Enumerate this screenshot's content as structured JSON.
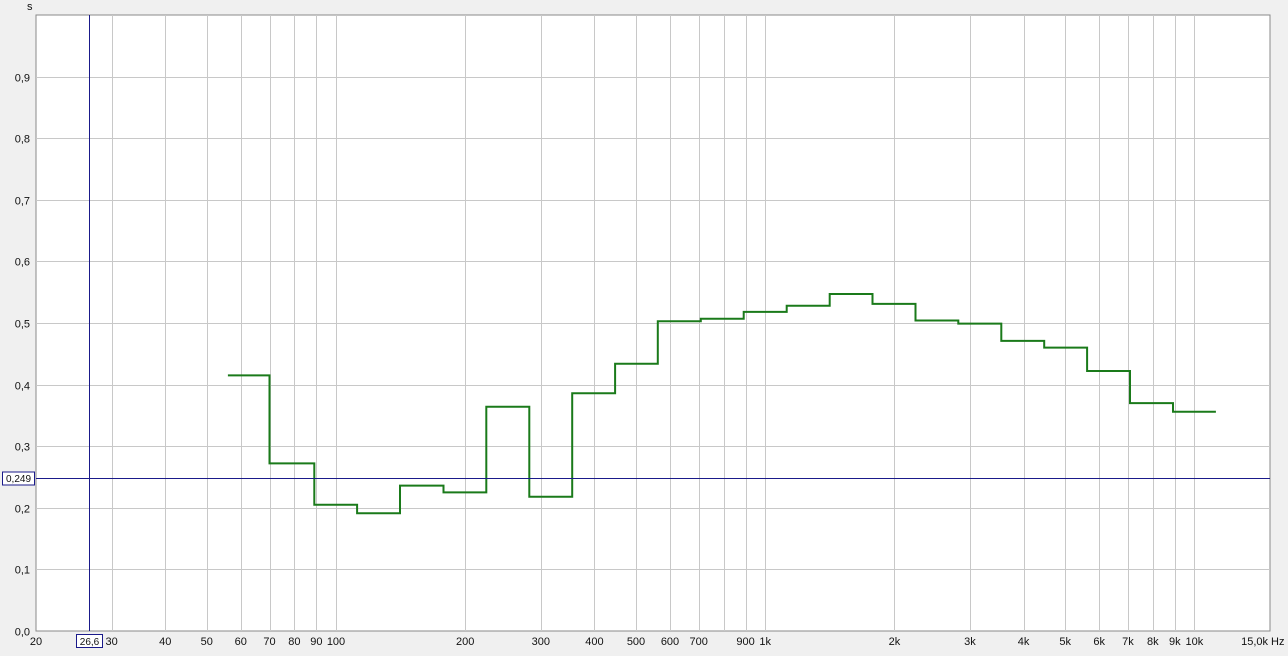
{
  "chart_data": {
    "type": "line",
    "title": "",
    "y_unit": "s",
    "x_unit": "Hz",
    "x_scale": "log",
    "xlim": [
      20,
      15000
    ],
    "ylim": [
      0,
      1.0
    ],
    "grid": true,
    "x_tick_labels": [
      {
        "value": 20,
        "label": "20"
      },
      {
        "value": 30,
        "label": "30"
      },
      {
        "value": 40,
        "label": "40"
      },
      {
        "value": 50,
        "label": "50"
      },
      {
        "value": 60,
        "label": "60"
      },
      {
        "value": 70,
        "label": "70"
      },
      {
        "value": 80,
        "label": "80"
      },
      {
        "value": 90,
        "label": "90"
      },
      {
        "value": 100,
        "label": "100"
      },
      {
        "value": 200,
        "label": "200"
      },
      {
        "value": 300,
        "label": "300"
      },
      {
        "value": 400,
        "label": "400"
      },
      {
        "value": 500,
        "label": "500"
      },
      {
        "value": 600,
        "label": "600"
      },
      {
        "value": 700,
        "label": "700"
      },
      {
        "value": 900,
        "label": "900"
      },
      {
        "value": 1000,
        "label": "1k"
      },
      {
        "value": 2000,
        "label": "2k"
      },
      {
        "value": 3000,
        "label": "3k"
      },
      {
        "value": 4000,
        "label": "4k"
      },
      {
        "value": 5000,
        "label": "5k"
      },
      {
        "value": 6000,
        "label": "6k"
      },
      {
        "value": 7000,
        "label": "7k"
      },
      {
        "value": 8000,
        "label": "8k"
      },
      {
        "value": 9000,
        "label": "9k"
      },
      {
        "value": 10000,
        "label": "10k"
      },
      {
        "value": 15000,
        "label": "15,0k"
      }
    ],
    "x_grid_values": [
      30,
      40,
      50,
      60,
      70,
      80,
      90,
      100,
      200,
      300,
      400,
      500,
      600,
      700,
      800,
      900,
      1000,
      2000,
      3000,
      4000,
      5000,
      6000,
      7000,
      8000,
      9000,
      10000
    ],
    "y_tick_labels": [
      {
        "value": 0.0,
        "label": "0,0"
      },
      {
        "value": 0.1,
        "label": "0,1"
      },
      {
        "value": 0.2,
        "label": "0,2"
      },
      {
        "value": 0.3,
        "label": "0,3"
      },
      {
        "value": 0.4,
        "label": "0,4"
      },
      {
        "value": 0.5,
        "label": "0,5"
      },
      {
        "value": 0.6,
        "label": "0,6"
      },
      {
        "value": 0.7,
        "label": "0,7"
      },
      {
        "value": 0.8,
        "label": "0,8"
      },
      {
        "value": 0.9,
        "label": "0,9"
      }
    ],
    "series": [
      {
        "color": "#1a7a1a",
        "step": true,
        "bands": [
          {
            "x0": 56,
            "x1": 70,
            "y": 0.415
          },
          {
            "x0": 70,
            "x1": 89,
            "y": 0.272
          },
          {
            "x0": 89,
            "x1": 112,
            "y": 0.205
          },
          {
            "x0": 112,
            "x1": 141,
            "y": 0.191
          },
          {
            "x0": 141,
            "x1": 178,
            "y": 0.236
          },
          {
            "x0": 178,
            "x1": 224,
            "y": 0.225
          },
          {
            "x0": 224,
            "x1": 282,
            "y": 0.364
          },
          {
            "x0": 282,
            "x1": 355,
            "y": 0.218
          },
          {
            "x0": 355,
            "x1": 447,
            "y": 0.386
          },
          {
            "x0": 447,
            "x1": 562,
            "y": 0.434
          },
          {
            "x0": 562,
            "x1": 708,
            "y": 0.503
          },
          {
            "x0": 708,
            "x1": 891,
            "y": 0.507
          },
          {
            "x0": 891,
            "x1": 1122,
            "y": 0.518
          },
          {
            "x0": 1122,
            "x1": 1413,
            "y": 0.528
          },
          {
            "x0": 1413,
            "x1": 1778,
            "y": 0.547
          },
          {
            "x0": 1778,
            "x1": 2239,
            "y": 0.531
          },
          {
            "x0": 2239,
            "x1": 2818,
            "y": 0.504
          },
          {
            "x0": 2818,
            "x1": 3548,
            "y": 0.499
          },
          {
            "x0": 3548,
            "x1": 4467,
            "y": 0.471
          },
          {
            "x0": 4467,
            "x1": 5623,
            "y": 0.46
          },
          {
            "x0": 5623,
            "x1": 7079,
            "y": 0.422
          },
          {
            "x0": 7079,
            "x1": 8913,
            "y": 0.37
          },
          {
            "x0": 8913,
            "x1": 11220,
            "y": 0.356
          }
        ]
      }
    ],
    "cursor": {
      "x_label": "26,6",
      "y_label": "0,249",
      "x_value": 26.6,
      "y_value": 0.249,
      "color": "#1a1a8a"
    }
  }
}
